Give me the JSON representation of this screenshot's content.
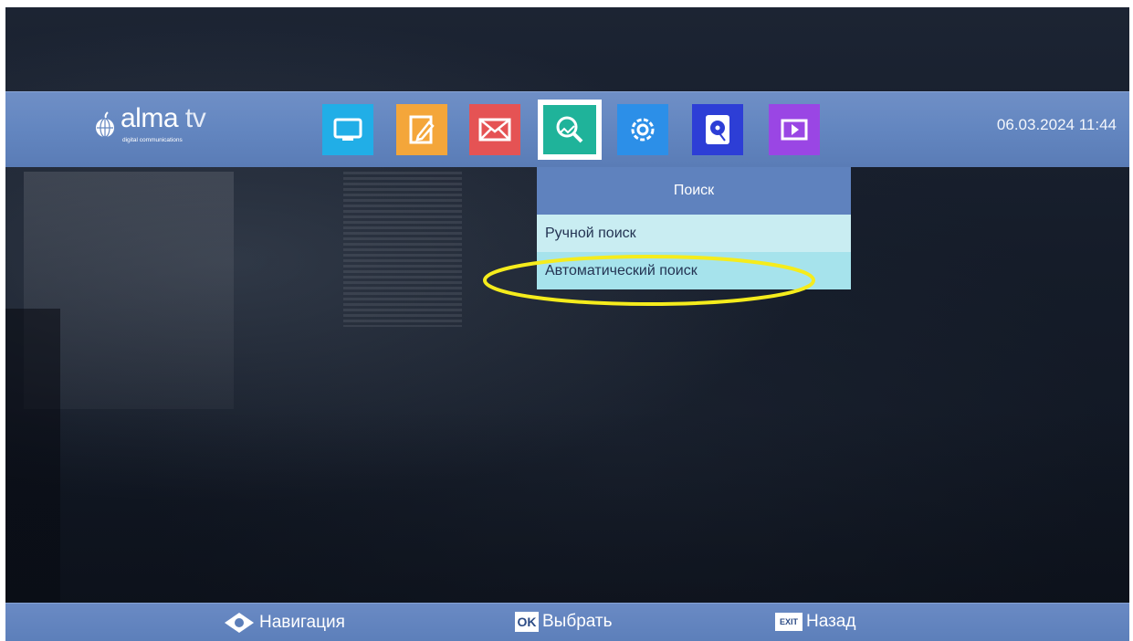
{
  "brand": {
    "name_main": "alma",
    "name_suffix": "tv",
    "tagline": "digital communications"
  },
  "datetime": "06.03.2024 11:44",
  "menu": {
    "icons": [
      {
        "name": "tv-icon",
        "color": "#21aee7"
      },
      {
        "name": "edit-icon",
        "color": "#f4a63a"
      },
      {
        "name": "mail-icon",
        "color": "#e55354"
      },
      {
        "name": "search-icon",
        "color": "#1fb39a",
        "selected": true
      },
      {
        "name": "settings-icon",
        "color": "#2c8fe8"
      },
      {
        "name": "storage-icon",
        "color": "#2d3ed6"
      },
      {
        "name": "media-player-icon",
        "color": "#9a46e4"
      }
    ]
  },
  "dropdown": {
    "title": "Поиск",
    "items": [
      {
        "label": "Ручной поиск"
      },
      {
        "label": "Автоматический поиск"
      }
    ],
    "highlight_color": "#f5ec1c"
  },
  "footer": {
    "navigate_label": "Навигация",
    "ok_key": "OK",
    "select_label": "Выбрать",
    "exit_key": "EXIT",
    "back_label": "Назад"
  }
}
